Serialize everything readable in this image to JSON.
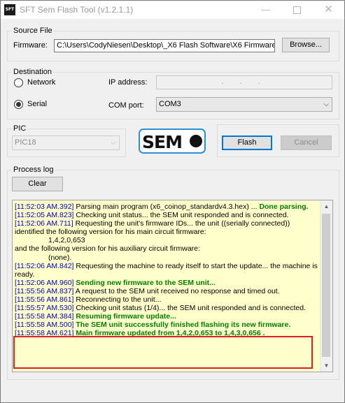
{
  "window": {
    "title": "SFT Sem Flash Tool  (v1.2.1.1)",
    "icon_text": "SFT",
    "minimize_glyph": "—",
    "close_glyph": "✕"
  },
  "source_file": {
    "group_label": "Source File",
    "firmware_label": "Firmware:",
    "firmware_path": "C:\\Users\\CodyNiesen\\Desktop\\_X6 Flash Software\\X6 Firmware",
    "browse_label": "Browse..."
  },
  "destination": {
    "group_label": "Destination",
    "network_label": "Network",
    "serial_label": "Serial",
    "selected": "serial",
    "ip_label": "IP address:",
    "ip_placeholder": ". . .",
    "com_label": "COM port:",
    "com_value": "COM3"
  },
  "pic": {
    "group_label": "PIC",
    "value": "PIC18"
  },
  "logo_text": "SEM",
  "actions": {
    "flash_label": "Flash",
    "cancel_label": "Cancel"
  },
  "process_log": {
    "group_label": "Process log",
    "clear_label": "Clear",
    "entries": [
      {
        "ts": "[11:52:03 AM.392]",
        "text": "  Parsing main program (x6_coinop_standardv4.3.hex) ... ",
        "bold": "Done parsing."
      },
      {
        "ts": "[11:52:05 AM.823]",
        "text": "  Checking unit status... the SEM unit responded and is connected."
      },
      {
        "ts": "[11:52:06 AM.711]",
        "text": "  Requesting the unit's firmware IDs... the unit ((serially connected)) identified the following version for his main circuit firmware:"
      },
      {
        "indent": "1,4,2,0,653"
      },
      {
        "plain": "and the following version for his auxiliary circuit firmware:"
      },
      {
        "indent": "(none)."
      },
      {
        "ts": "[11:52:06 AM.842]",
        "text": "  Requesting the machine to ready itself to start the update... the machine is ready."
      },
      {
        "ts": "[11:52:06 AM.960]",
        "bold": "  Sending new firmware to the SEM unit..."
      },
      {
        "ts": "[11:55:56 AM.837]",
        "text": "  A request to the SEM unit received no response and timed out."
      },
      {
        "ts": "[11:55:56 AM.861]",
        "text": "  Reconnecting to the unit..."
      },
      {
        "ts": "[11:55:57 AM.530]",
        "text": "  Checking unit status (1/4)... the SEM unit responded and is connected."
      },
      {
        "ts": "[11:55:58 AM.384]",
        "bold": "  Resuming firmware update..."
      },
      {
        "ts": "[11:55:58 AM.500]",
        "bold": "  The SEM unit successfully finished flashing its new firmware."
      },
      {
        "ts": "[11:55:58 AM.621]",
        "bold": "  Main firmware updated from 1,4,2,0,653 to 1,4,3,0,656 ."
      }
    ]
  },
  "colors": {
    "log_background": "#ffffcc",
    "timestamp": "#0000b4",
    "success_text": "#008000",
    "highlight_border": "#e02020"
  }
}
